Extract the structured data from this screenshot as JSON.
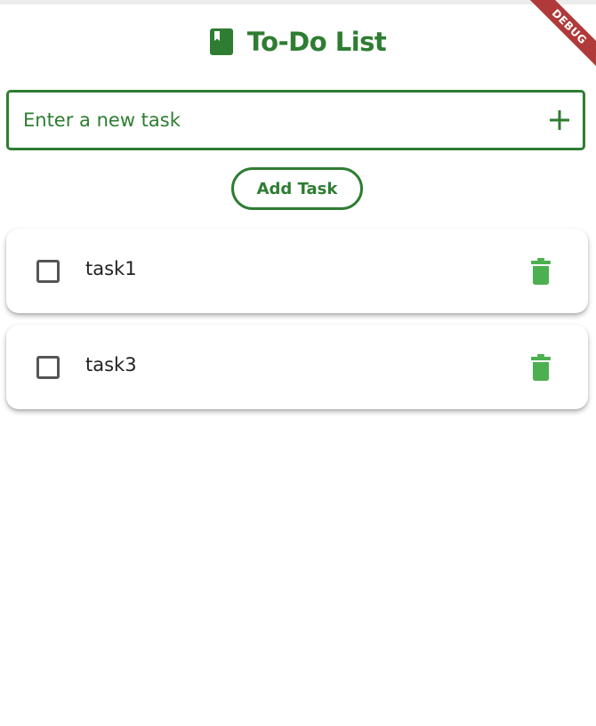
{
  "header": {
    "title": "To-Do List",
    "icon": "book-icon"
  },
  "debug_banner": {
    "label": "DEBUG"
  },
  "input": {
    "placeholder": "Enter a new task",
    "value": "",
    "add_icon": "plus-icon"
  },
  "add_button": {
    "label": "Add Task"
  },
  "tasks": [
    {
      "label": "task1",
      "checked": false,
      "delete_icon": "trash-icon"
    },
    {
      "label": "task3",
      "checked": false,
      "delete_icon": "trash-icon"
    }
  ],
  "colors": {
    "primary": "#2e7d32",
    "delete": "#4caf50",
    "debug": "#b03a3a",
    "checkbox": "#555555"
  }
}
